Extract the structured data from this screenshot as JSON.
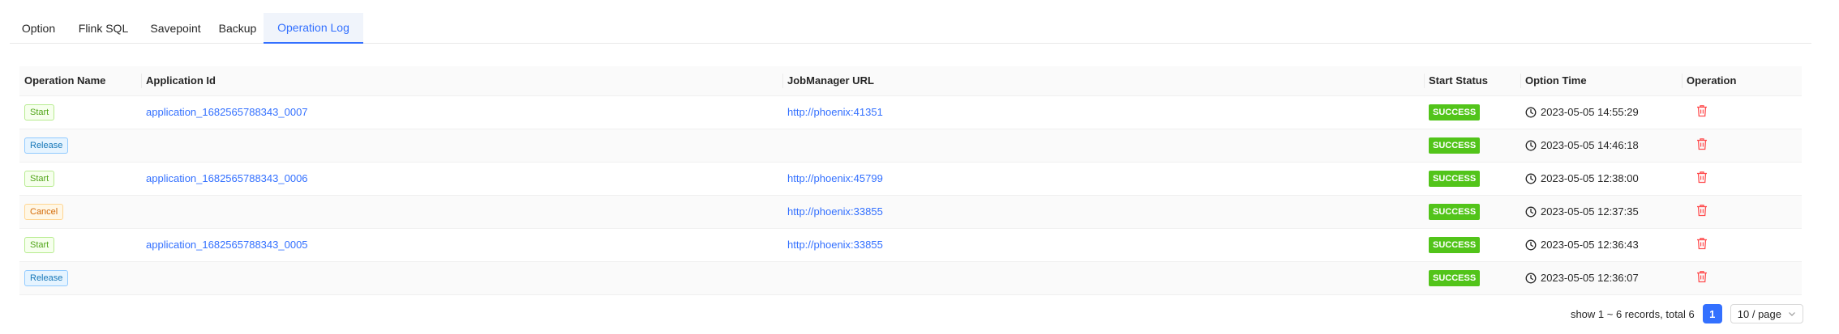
{
  "tabs": [
    {
      "label": "Option",
      "active": false
    },
    {
      "label": "Flink SQL",
      "active": false
    },
    {
      "label": "Savepoint",
      "active": false
    },
    {
      "label": "Backup",
      "active": false
    },
    {
      "label": "Operation Log",
      "active": true
    }
  ],
  "table": {
    "columns": [
      "Operation Name",
      "Application Id",
      "JobManager URL",
      "Start Status",
      "Option Time",
      "Operation"
    ],
    "rows": [
      {
        "operation": "Start",
        "op_color": "green",
        "app_id": "application_1682565788343_0007",
        "jm_url": "http://phoenix:41351",
        "status": "SUCCESS",
        "time": "2023-05-05 14:55:29"
      },
      {
        "operation": "Release",
        "op_color": "blue",
        "app_id": "",
        "jm_url": "",
        "status": "SUCCESS",
        "time": "2023-05-05 14:46:18"
      },
      {
        "operation": "Start",
        "op_color": "green",
        "app_id": "application_1682565788343_0006",
        "jm_url": "http://phoenix:45799",
        "status": "SUCCESS",
        "time": "2023-05-05 12:38:00"
      },
      {
        "operation": "Cancel",
        "op_color": "orange",
        "app_id": "",
        "jm_url": "http://phoenix:33855",
        "status": "SUCCESS",
        "time": "2023-05-05 12:37:35"
      },
      {
        "operation": "Start",
        "op_color": "green",
        "app_id": "application_1682565788343_0005",
        "jm_url": "http://phoenix:33855",
        "status": "SUCCESS",
        "time": "2023-05-05 12:36:43"
      },
      {
        "operation": "Release",
        "op_color": "blue",
        "app_id": "",
        "jm_url": "",
        "status": "SUCCESS",
        "time": "2023-05-05 12:36:07"
      }
    ]
  },
  "pagination": {
    "summary": "show 1 ~ 6 records, total 6",
    "current_page": "1",
    "page_size": "10 / page"
  },
  "icons": {
    "clock": "clock-icon",
    "delete": "delete-icon",
    "chevron": "chevron-down-icon"
  },
  "colors": {
    "accent": "#3370ff",
    "success": "#52c41a",
    "danger": "#ff4d4f"
  }
}
